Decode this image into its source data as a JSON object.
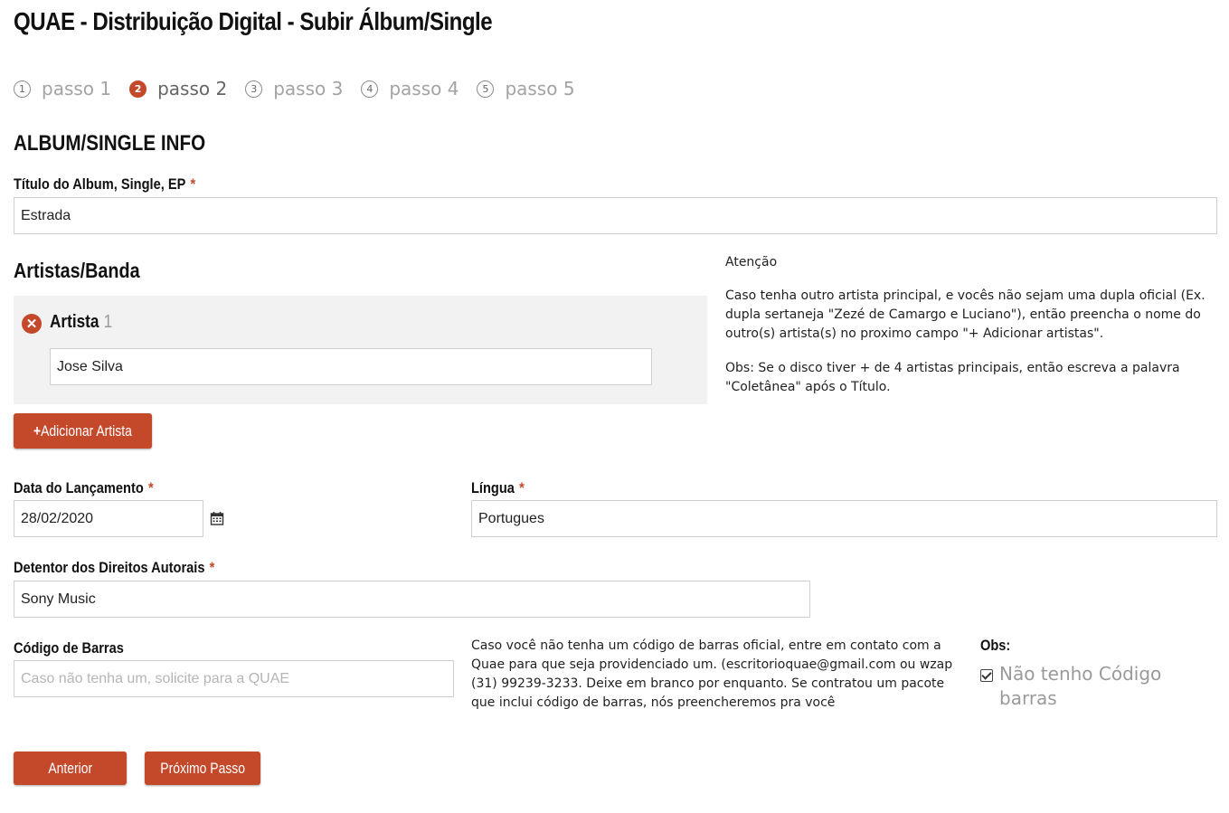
{
  "page": {
    "title": "QUAE - Distribuição Digital - Subir Álbum/Single"
  },
  "steps": [
    {
      "num": "1",
      "label": "passo 1",
      "active": false
    },
    {
      "num": "2",
      "label": "passo 2",
      "active": true
    },
    {
      "num": "3",
      "label": "passo 3",
      "active": false
    },
    {
      "num": "4",
      "label": "passo 4",
      "active": false
    },
    {
      "num": "5",
      "label": "passo 5",
      "active": false
    }
  ],
  "form": {
    "section_title": "ALBUM/SINGLE INFO",
    "album_title": {
      "label": "Título do Album, Single, EP",
      "required": "*",
      "value": "Estrada"
    },
    "artists": {
      "heading": "Artistas/Banda",
      "items": [
        {
          "label": "Artista",
          "number": "1",
          "value": "Jose Silva"
        }
      ],
      "add_button": "Adicionar Artista",
      "add_icon": "+"
    },
    "release_date": {
      "label": "Data do Lançamento",
      "required": "*",
      "value": "28/02/2020"
    },
    "language": {
      "label": "Língua",
      "required": "*",
      "value": "Portugues"
    },
    "copyright": {
      "label": "Detentor dos Direitos Autorais",
      "required": "*",
      "value": "Sony Music"
    },
    "barcode": {
      "label": "Código de Barras",
      "value": "",
      "placeholder": "Caso não tenha um, solicite para a QUAE"
    },
    "barcode_note": "Caso você não tenha um código de barras oficial, entre em contato com a Quae para que seja providenciado um. (escritorioquae@gmail.com ou wzap (31) 99239-3233. Deixe em branco por enquanto. Se contratou um pacote que inclui código de barras, nós preencheremos pra você",
    "obs": {
      "label": "Obs:",
      "checkbox_label": "Não tenho Código barras",
      "checked": true
    }
  },
  "attention": {
    "title": "Atenção",
    "paragraph1": "Caso tenha outro artista principal, e vocês não sejam uma dupla oficial (Ex. dupla sertaneja \"Zezé de Camargo e Luciano\"), então preencha o nome do outro(s) artista(s) no proximo campo \"+ Adicionar artistas\".",
    "paragraph2": "Obs: Se o disco tiver + de 4 artistas principais, então escreva a palavra \"Coletânea\" após o Título."
  },
  "navigation": {
    "previous": "Anterior",
    "next": "Próximo Passo"
  },
  "colors": {
    "accent": "#c4492b"
  },
  "icons": {
    "remove": "remove-artist-icon",
    "calendar": "calendar-icon",
    "checkbox": "checkbox-checked-icon"
  }
}
